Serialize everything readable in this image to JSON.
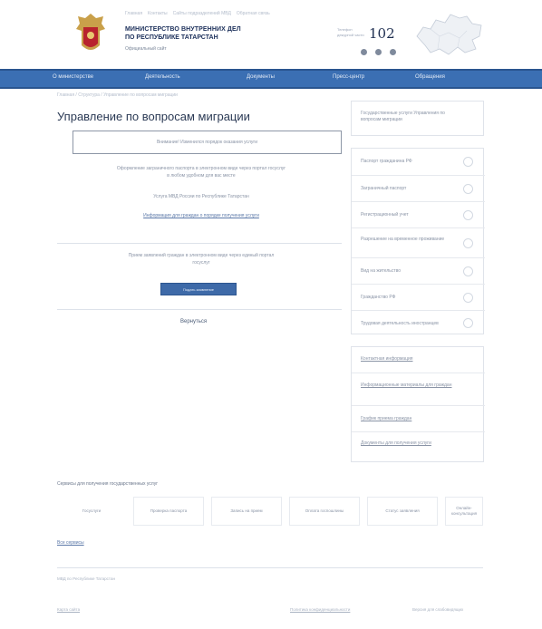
{
  "header": {
    "top_links": [
      "Главная",
      "Контакты",
      "Сайты подразделений МВД",
      "Обратная связь"
    ],
    "ministry_line1": "МИНИСТЕРСТВО ВНУТРЕННИХ ДЕЛ",
    "ministry_line2": "ПО РЕСПУБЛИКЕ ТАТАРСТАН",
    "subtitle": "Официальный сайт",
    "hotline_label": "Телефон дежурной части",
    "hotline_number": "102",
    "social_icons": [
      "vk-icon",
      "twitter-icon",
      "rss-icon"
    ]
  },
  "nav": {
    "items": [
      "О министерстве",
      "Деятельность",
      "Документы",
      "Пресс-центр",
      "Обращения"
    ]
  },
  "breadcrumb": "Главная / Структура / Управление по вопросам миграции",
  "main": {
    "title": "Управление по вопросам миграции",
    "notice": "Внимание! Изменился порядок оказания услуги",
    "para1_line1": "Оформление заграничного паспорта в электронном виде через портал госуслуг",
    "para1_line2": "в любом удобном для вас месте",
    "para2": "Услуга МВД России по Республике Татарстан",
    "link1": "Информация для граждан о порядке получения услуги",
    "para3_line1": "Прием заявлений граждан в электронном виде через единый портал",
    "para3_line2": "госуслуг",
    "apply_button": "Подать заявление",
    "back_link": "Вернуться"
  },
  "right_col": {
    "header_box": "Государственные услуги Управления по вопросам миграции",
    "services": [
      "Паспорт гражданина РФ",
      "Заграничный паспорт",
      "Регистрационный учет",
      "Разрешение на временное проживание",
      "Вид на жительство",
      "Гражданство РФ",
      "Трудовая деятельность иностранцев"
    ],
    "info_box": [
      "Контактная информация",
      "Информационные материалы для граждан",
      "График приема граждан",
      "Документы для получения услуги"
    ]
  },
  "services_bar": {
    "title": "Сервисы для получения государственных услуг",
    "items": [
      "Госуслуги",
      "Проверка паспорта",
      "Запись на прием",
      "Оплата госпошлины",
      "Статус заявления",
      "Онлайн-консультация"
    ],
    "all_link": "Все сервисы"
  },
  "footer": {
    "copyright": "МВД по Республике Татарстан",
    "left_link": "Карта сайта",
    "right_link": "Политика конфиденциальности",
    "right_link2": "Версия для слабовидящих"
  }
}
